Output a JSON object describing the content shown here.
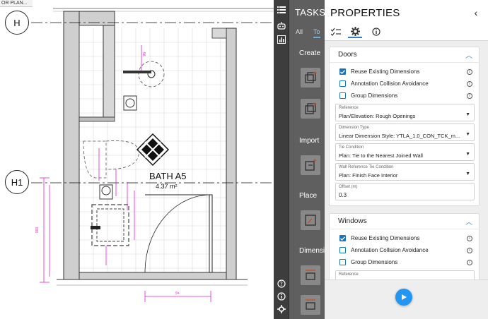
{
  "document": {
    "tab_label": "OR PLAN...",
    "grid_lines": [
      "H",
      "H1"
    ],
    "room": {
      "name": "BATH A5",
      "area": "4.37 m²"
    }
  },
  "rail": {
    "icons": [
      "list-icon",
      "robot-icon",
      "chart-icon",
      "help-icon",
      "info-icon",
      "gear-icon"
    ]
  },
  "tasks": {
    "title": "TASKS",
    "tabs": [
      "All",
      "To"
    ],
    "sections": [
      "Create",
      "Import",
      "Place",
      "Dimensi"
    ]
  },
  "properties": {
    "title": "PROPERTIES",
    "collapse_glyph": "‹",
    "tabs": [
      "checklist-icon",
      "gear-icon",
      "info-icon"
    ],
    "doors": {
      "title": "Doors",
      "options": [
        {
          "label": "Reuse Existing Dimensions",
          "checked": true
        },
        {
          "label": "Annotation Collision Avoidance",
          "checked": false
        },
        {
          "label": "Group Dimensions",
          "checked": false
        }
      ],
      "fields": [
        {
          "label": "Reference",
          "value": "Plan/Elevation: Rough Openings"
        },
        {
          "label": "Dimension Type",
          "value": "Linear Dimension Style: YTLA_1.0_CON_TCK_m..."
        },
        {
          "label": "Tie Condition",
          "value": "Plan: Tie to the Nearest Joined Wall"
        },
        {
          "label": "Wall Reference Tie Condition",
          "value": "Plan: Finish Face Interior"
        }
      ],
      "offset": {
        "label": "Offset (m)",
        "value": "0.3"
      }
    },
    "windows": {
      "title": "Windows",
      "options": [
        {
          "label": "Reuse Existing Dimensions",
          "checked": true
        },
        {
          "label": "Annotation Collision Avoidance",
          "checked": false
        },
        {
          "label": "Group Dimensions",
          "checked": false
        }
      ],
      "reference_label": "Reference"
    }
  },
  "colors": {
    "accent": "#2196f3",
    "checkbox": "#1b75bb",
    "dimension": "#e020d0"
  }
}
